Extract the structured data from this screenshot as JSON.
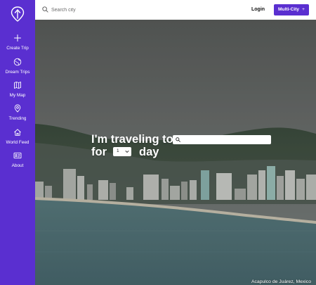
{
  "search": {
    "placeholder": "Search city"
  },
  "header": {
    "login_label": "Login",
    "multi_city_label": "Multi-City",
    "multi_city_icon": "+"
  },
  "sidebar": {
    "items": [
      {
        "label": "Create Trip",
        "icon": "plus-icon"
      },
      {
        "label": "Dream Trips",
        "icon": "globe-icon"
      },
      {
        "label": "My Map",
        "icon": "map-icon"
      },
      {
        "label": "Trending",
        "icon": "location-pin-icon"
      },
      {
        "label": "World Feed",
        "icon": "home-icon"
      },
      {
        "label": "About",
        "icon": "id-card-icon"
      }
    ]
  },
  "hero": {
    "line1": "I'm traveling to",
    "line2_prefix": "for",
    "line2_suffix": "day",
    "days_value": "1",
    "destination_placeholder": "",
    "photo_caption": "Acapulco de Juárez, Mexico"
  },
  "colors": {
    "accent": "#5a2fd0",
    "text_on_accent": "#ffffff"
  }
}
